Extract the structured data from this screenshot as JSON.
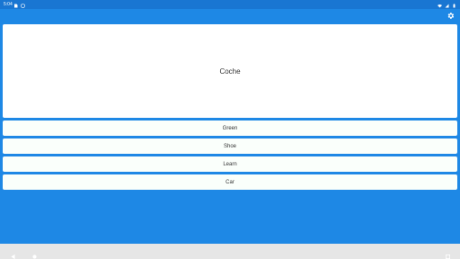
{
  "status_bar": {
    "time": "5:04",
    "left_icons": [
      "sd-card-icon",
      "shield-icon"
    ],
    "right_icons": [
      "wifi-icon",
      "cell-signal-icon",
      "battery-icon"
    ]
  },
  "toolbar": {
    "settings_icon": "gear-icon"
  },
  "prompt": {
    "word": "Coche"
  },
  "options": [
    {
      "label": "Green"
    },
    {
      "label": "Shoe"
    },
    {
      "label": "Learn"
    },
    {
      "label": "Car"
    }
  ],
  "nav_bar": {
    "icons": [
      "back-icon",
      "home-icon",
      "rotate-icon"
    ]
  },
  "colors": {
    "app_background": "#1e88e5",
    "status_bar": "#1976d2",
    "card": "#ffffff",
    "option": "#fafffb",
    "nav_bar": "#e6e6e6"
  }
}
